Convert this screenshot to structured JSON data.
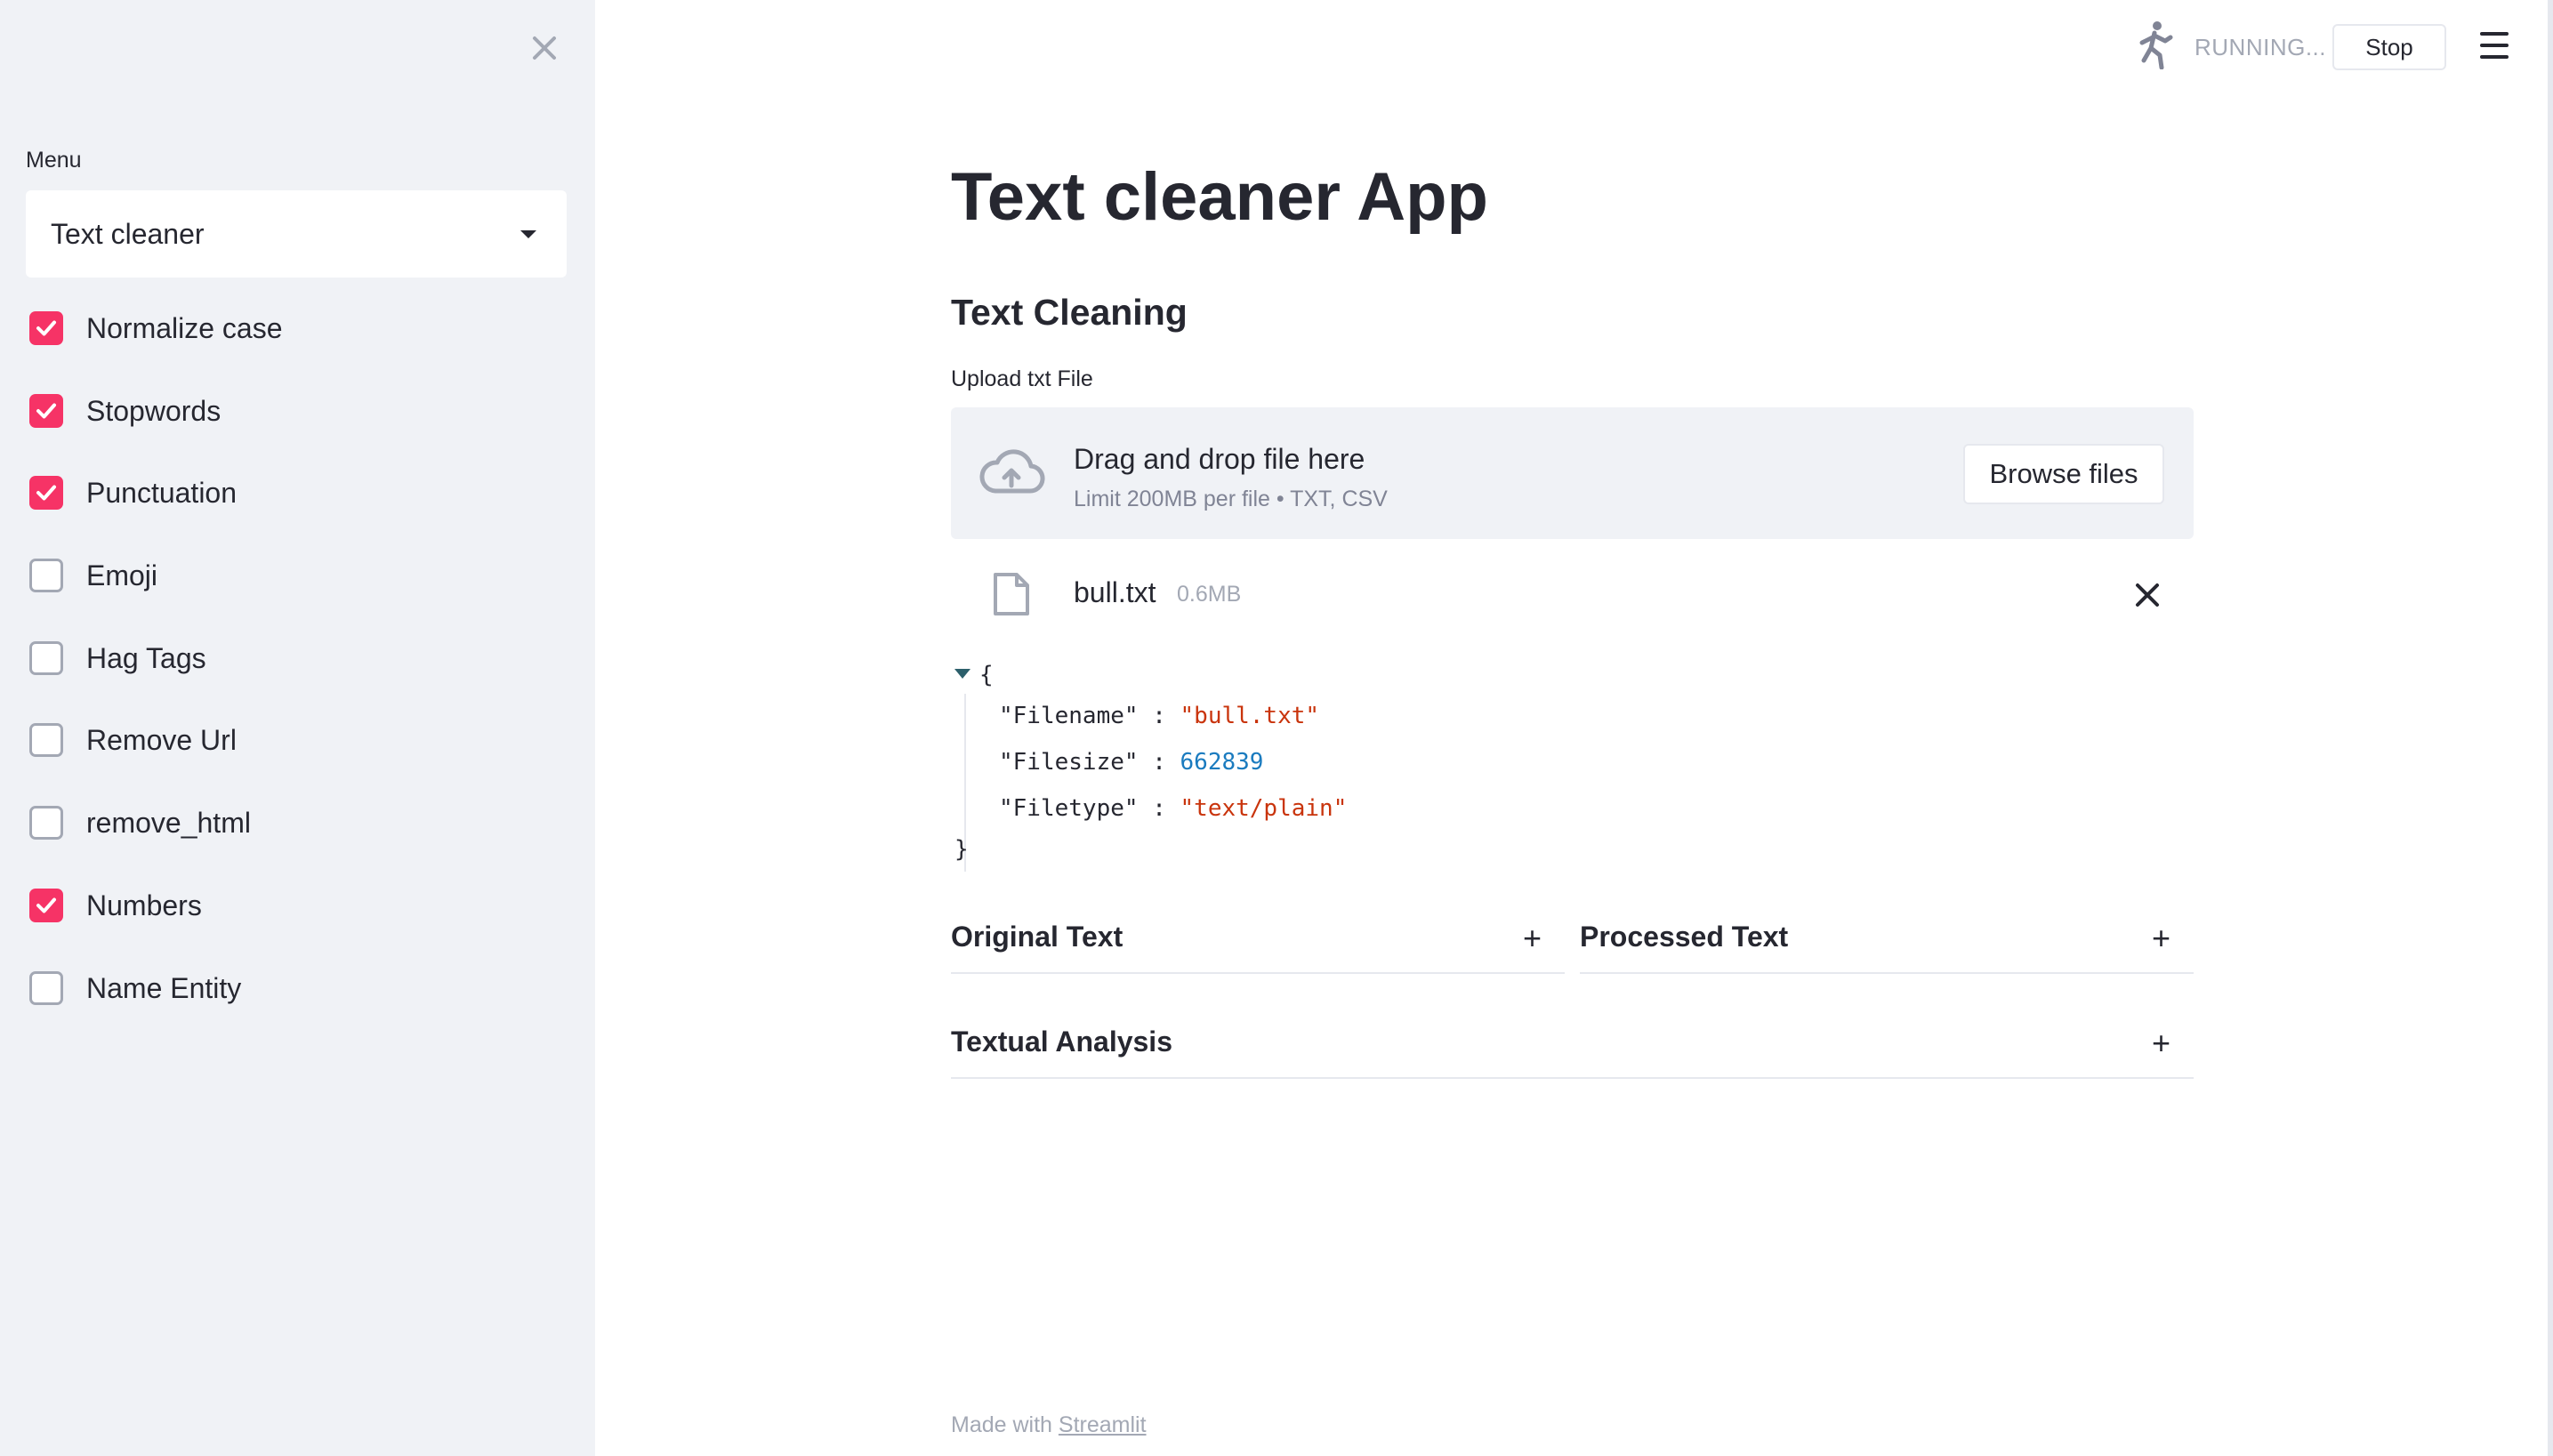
{
  "sidebar": {
    "menu_label": "Menu",
    "menu_selected": "Text cleaner",
    "options": [
      {
        "label": "Normalize case",
        "checked": true
      },
      {
        "label": "Stopwords",
        "checked": true
      },
      {
        "label": "Punctuation",
        "checked": true
      },
      {
        "label": "Emoji",
        "checked": false
      },
      {
        "label": "Hag Tags",
        "checked": false
      },
      {
        "label": "Remove Url",
        "checked": false
      },
      {
        "label": "remove_html",
        "checked": false
      },
      {
        "label": "Numbers",
        "checked": true
      },
      {
        "label": "Name Entity",
        "checked": false
      }
    ]
  },
  "header": {
    "status": "RUNNING...",
    "stop_label": "Stop"
  },
  "main": {
    "title": "Text cleaner App",
    "section_title": "Text Cleaning",
    "upload_label": "Upload txt File",
    "dropzone_title": "Drag and drop file here",
    "dropzone_limit": "Limit 200MB per file • TXT, CSV",
    "browse_label": "Browse files",
    "file_name": "bull.txt",
    "file_size": "0.6MB",
    "json_open": "{",
    "json_close": "}",
    "json_entries": [
      {
        "key": "\"Filename\"",
        "value": "\"bull.txt\""
      },
      {
        "key": "\"Filesize\"",
        "value": "662839"
      },
      {
        "key": "\"Filetype\"",
        "value": "\"text/plain\""
      }
    ],
    "expanders": {
      "original": "Original Text",
      "processed": "Processed Text",
      "analysis": "Textual Analysis"
    }
  },
  "footer": {
    "prefix": "Made with ",
    "link": "Streamlit"
  },
  "colors": {
    "accent": "#f63366",
    "sidebar_bg": "#f0f2f6",
    "json_string": "#c9340c",
    "json_number": "#1a7bbf"
  }
}
